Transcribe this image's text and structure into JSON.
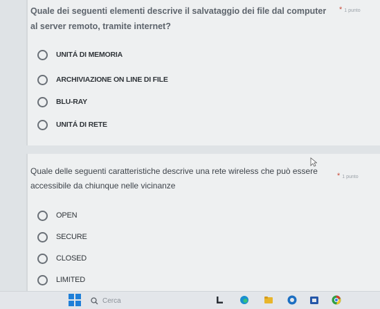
{
  "question1": {
    "text": "Quale dei seguenti elementi descrive il salvataggio dei file dal computer al server remoto, tramite internet?",
    "required_label": "1 punto",
    "options": [
      "UNITÁ DI MEMORIA",
      "ARCHIVIAZIONE ON LINE DI FILE",
      "BLU-RAY",
      "UNITÁ DI RETE"
    ]
  },
  "question2": {
    "text": "Quale delle seguenti caratteristiche descrive una rete wireless che può essere accessibile da chiunque nelle vicinanze",
    "required_label": "1 punto",
    "options": [
      "OPEN",
      "SECURE",
      "CLOSED",
      "LIMITED"
    ]
  },
  "taskbar": {
    "search_placeholder": "Cerca",
    "icons": [
      "windows-start-icon",
      "search-icon",
      "file-explorer-icon",
      "edge-icon",
      "folder-icon",
      "chrome-icon",
      "store-icon",
      "app-icon"
    ]
  },
  "colors": {
    "background": "#dfe3e6",
    "card": "#eef0f1",
    "required_star": "#c94b3a",
    "windows_blue": "#1f7fd8"
  }
}
